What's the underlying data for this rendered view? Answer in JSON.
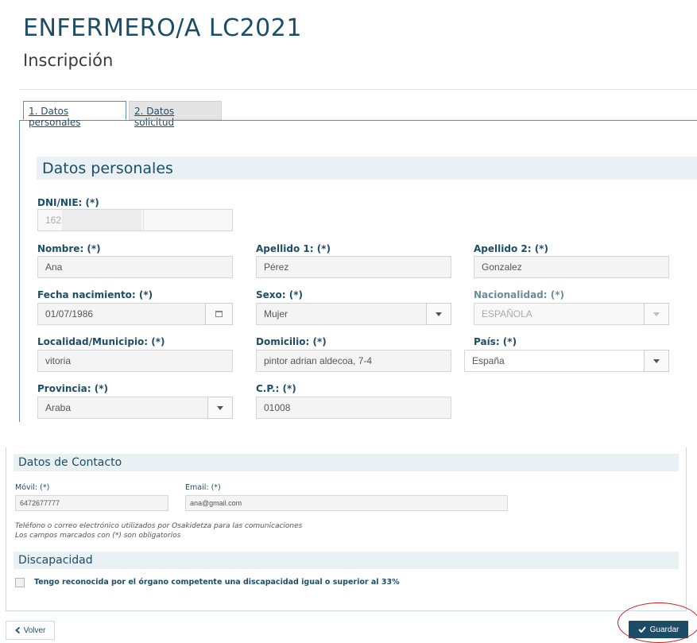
{
  "header": {
    "title": "ENFERMERO/A LC2021",
    "subtitle": "Inscripción"
  },
  "tabs": [
    {
      "label": "1. Datos personales",
      "active": true
    },
    {
      "label": "2. Datos solicitud",
      "active": false
    }
  ],
  "personal": {
    "section_title": "Datos personales",
    "dni": {
      "label": "DNI/NIE: (*)",
      "value": "162"
    },
    "nombre": {
      "label": "Nombre: (*)",
      "value": "Ana"
    },
    "apellido1": {
      "label": "Apellido 1: (*)",
      "value": "Pérez"
    },
    "apellido2": {
      "label": "Apellido 2: (*)",
      "value": "Gonzalez"
    },
    "fecha": {
      "label": "Fecha nacimiento: (*)",
      "value": "01/07/1986"
    },
    "sexo": {
      "label": "Sexo: (*)",
      "value": "Mujer"
    },
    "nacionalidad": {
      "label": "Nacionalidad: (*)",
      "value": "ESPAÑOLA"
    },
    "localidad": {
      "label": "Localidad/Municipio: (*)",
      "value": "vitoria"
    },
    "domicilio": {
      "label": "Domicilio: (*)",
      "value": "pintor adrian aldecoa, 7-4"
    },
    "pais": {
      "label": "País: (*)",
      "value": "España"
    },
    "provincia": {
      "label": "Provincia: (*)",
      "value": "Araba"
    },
    "cp": {
      "label": "C.P.: (*)",
      "value": "01008"
    }
  },
  "contacto": {
    "section_title": "Datos de Contacto",
    "movil": {
      "label": "Móvil: (*)",
      "value": "6472677777"
    },
    "email": {
      "label": "Email: (*)",
      "value": "ana@gmail.com"
    },
    "note1": "Teléfono o correo electrónico utilizados por Osakidetza para las comunicaciones",
    "note2": "Los campos marcados con (*) son obligatorios"
  },
  "discapacidad": {
    "section_title": "Discapacidad",
    "checkbox_label": "Tengo reconocida por el órgano competente una discapacidad igual o superior al 33%",
    "checked": false
  },
  "actions": {
    "back_label": "Volver",
    "save_label": "Guardar"
  },
  "colors": {
    "primary": "#1c4d66",
    "band": "#e9f1f5",
    "highlight": "#d11a1a"
  }
}
